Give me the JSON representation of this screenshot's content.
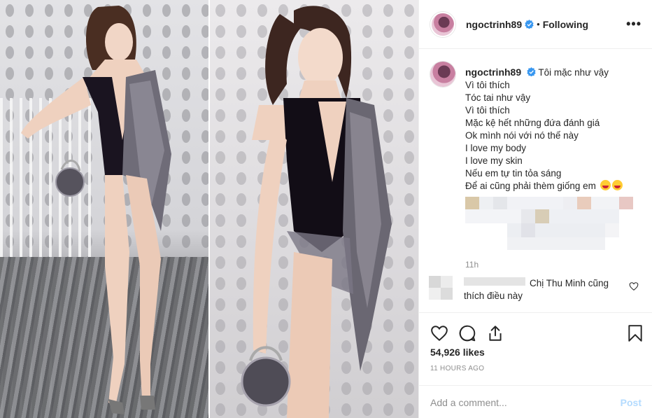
{
  "post": {
    "username": "ngoctrinh89",
    "separator": "•",
    "follow_status": "Following",
    "more_label": "•••",
    "caption_lines": [
      "Tôi mặc như vậy",
      "Vì tôi thích",
      "Tóc tai như vậy",
      "Vì tôi thích",
      "Mặc kệ hết những đứa đánh giá",
      "Ok mình nói với nó thế này",
      "I love my body",
      "I love my skin",
      "Nếu em tự tin tỏa sáng",
      "Để ai cũng phải thèm giống em"
    ],
    "caption_emojis": [
      "face-savoring-emoji",
      "grinning-tongue-emoji"
    ],
    "caption_time": "11h"
  },
  "comment": {
    "text": "Chị Thu Minh cũng thích điều này"
  },
  "actions": {
    "likes": "54,926 likes",
    "time_ago": "11 HOURS AGO",
    "comment_placeholder": "Add a comment...",
    "post_label": "Post"
  },
  "colors": {
    "verified_blue": "#3897f0",
    "post_button": "#b3dbff",
    "muted_text": "#8e8e8e",
    "divider": "#efefef"
  }
}
